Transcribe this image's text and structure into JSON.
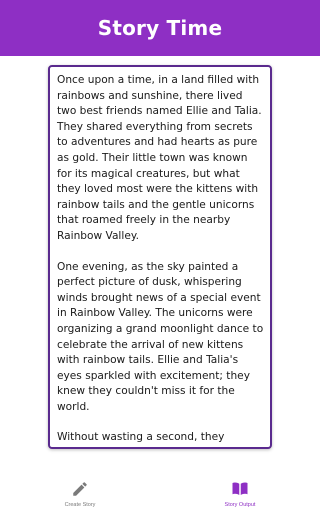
{
  "app_bar": {
    "title": "Story Time"
  },
  "story": {
    "paragraphs": [
      "Once upon a time, in a land filled with rainbows and sunshine, there lived two best friends named Ellie and Talia. They shared everything from secrets to adventures and had hearts as pure as gold. Their little town was known for its magical creatures, but what they loved most were the kittens with rainbow tails and the gentle unicorns that roamed freely in the nearby Rainbow Valley.",
      "One evening, as the sky painted a perfect picture of dusk, whispering winds brought news of a special event in Rainbow Valley. The unicorns were organizing a grand moonlight dance to celebrate the arrival of new kittens with rainbow tails. Ellie and Talia's eyes sparkled with excitement; they knew they couldn't miss it for the world.",
      "Without wasting a second, they packed their favorite treats - honey cookies for Ellie and strawberry marshmallows for Talia - and set off on their adventure. As"
    ]
  },
  "bottom_nav": {
    "items": [
      {
        "label": "Create Story",
        "icon": "pencil-icon",
        "active": false
      },
      {
        "label": "Story Output",
        "icon": "book-icon",
        "active": true
      }
    ]
  },
  "colors": {
    "primary": "#8e2fc4",
    "card_border": "#5a2a8e",
    "inactive": "#7a7a7a"
  }
}
